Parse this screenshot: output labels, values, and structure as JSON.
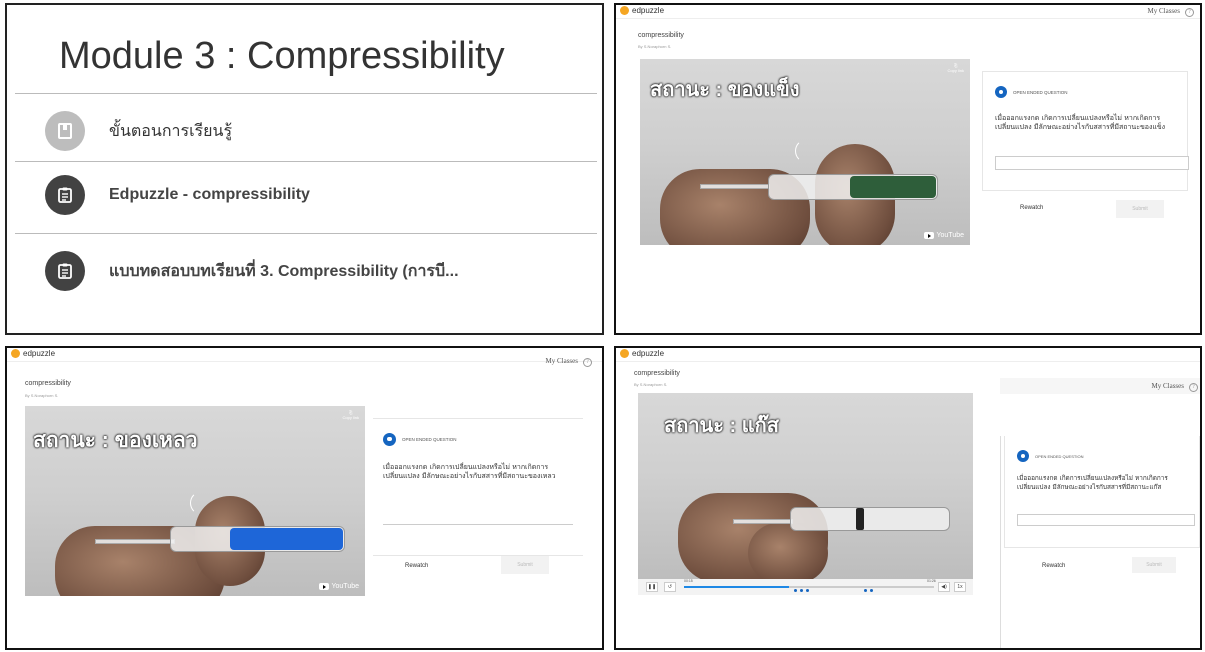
{
  "module": {
    "title": "Module 3 : Compressibility",
    "items": [
      {
        "label": "ขั้นตอนการเรียนรู้",
        "icon": "page-icon"
      },
      {
        "label": "Edpuzzle - compressibility",
        "icon": "assignment-icon"
      },
      {
        "label": "แบบทดสอบบทเรียนที่ 3. Compressibility (การบี...",
        "icon": "assignment-icon"
      }
    ]
  },
  "edpuzzle": {
    "logo": "edpuzzle",
    "my_classes": "My Classes",
    "help": "?",
    "video_title": "compressibility",
    "author": "By S.Noraphorn S.",
    "copy_to": "Copy link",
    "youtube": "YouTube",
    "question_type": "OPEN ENDED QUESTION",
    "rewatch": "Rewatch",
    "submit": "Submit"
  },
  "screens": [
    {
      "state_label": "สถานะ : ของแข็ง",
      "question": "เมื่อออกแรงกด เกิดการเปลี่ยนแปลงหรือไม่ หากเกิดการเปลี่ยนแปลง มีลักษณะอย่างไรกับสสารที่มีสถานะของแข็ง",
      "liquid_color": "#2e5e3a"
    },
    {
      "state_label": "สถานะ : ของเหลว",
      "question": "เมื่อออกแรงกด เกิดการเปลี่ยนแปลงหรือไม่ หากเกิดการเปลี่ยนแปลง มีลักษณะอย่างไรกับสสารที่มีสถานะของเหลว",
      "liquid_color": "#1e66d8"
    },
    {
      "state_label": "สถานะ : แก๊ส",
      "question": "เมื่อออกแรงกด เกิดการเปลี่ยนแปลงหรือไม่ หากเกิดการเปลี่ยนแปลง มีลักษณะอย่างไรกับสสารที่มีสถานะแก๊ส",
      "liquid_color": "#e8e8e8",
      "time_start": "00:15",
      "time_end": "01:26",
      "progress": 0.42,
      "speed": "1x"
    }
  ],
  "colors": {
    "accent": "#1565c0",
    "logo": "#f5a623"
  }
}
